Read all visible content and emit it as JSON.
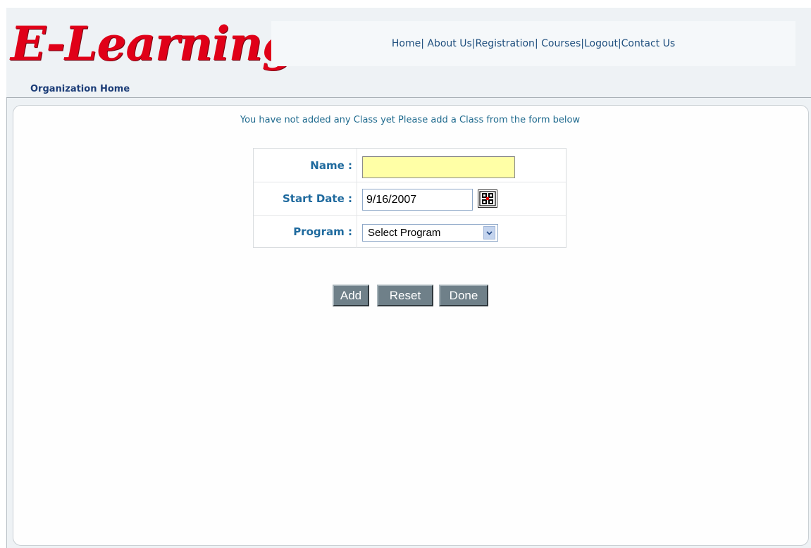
{
  "header": {
    "logo_text": "E-Learning",
    "nav": [
      {
        "label": "Home"
      },
      {
        "label": "About Us"
      },
      {
        "label": "Registration"
      },
      {
        "label": "Courses"
      },
      {
        "label": "Logout"
      },
      {
        "label": "Contact Us"
      }
    ],
    "subnav_label": "Organization Home"
  },
  "main": {
    "message": "You have not added any Class yet Please add a Class from the form below",
    "form": {
      "name_label": "Name :",
      "name_value": "",
      "start_date_label": "Start Date :",
      "start_date_value": "9/16/2007",
      "program_label": "Program :",
      "program_selected": "Select Program"
    },
    "buttons": {
      "add": "Add",
      "reset": "Reset",
      "done": "Done"
    }
  },
  "icons": {
    "calendar": "calendar-icon",
    "dropdown": "chevron-down-icon"
  },
  "colors": {
    "logo": "#e00018",
    "link": "#1f4f7e",
    "label": "#1f6a9e",
    "name_field_bg": "#ffffa6",
    "button_bg": "#6f8089"
  }
}
